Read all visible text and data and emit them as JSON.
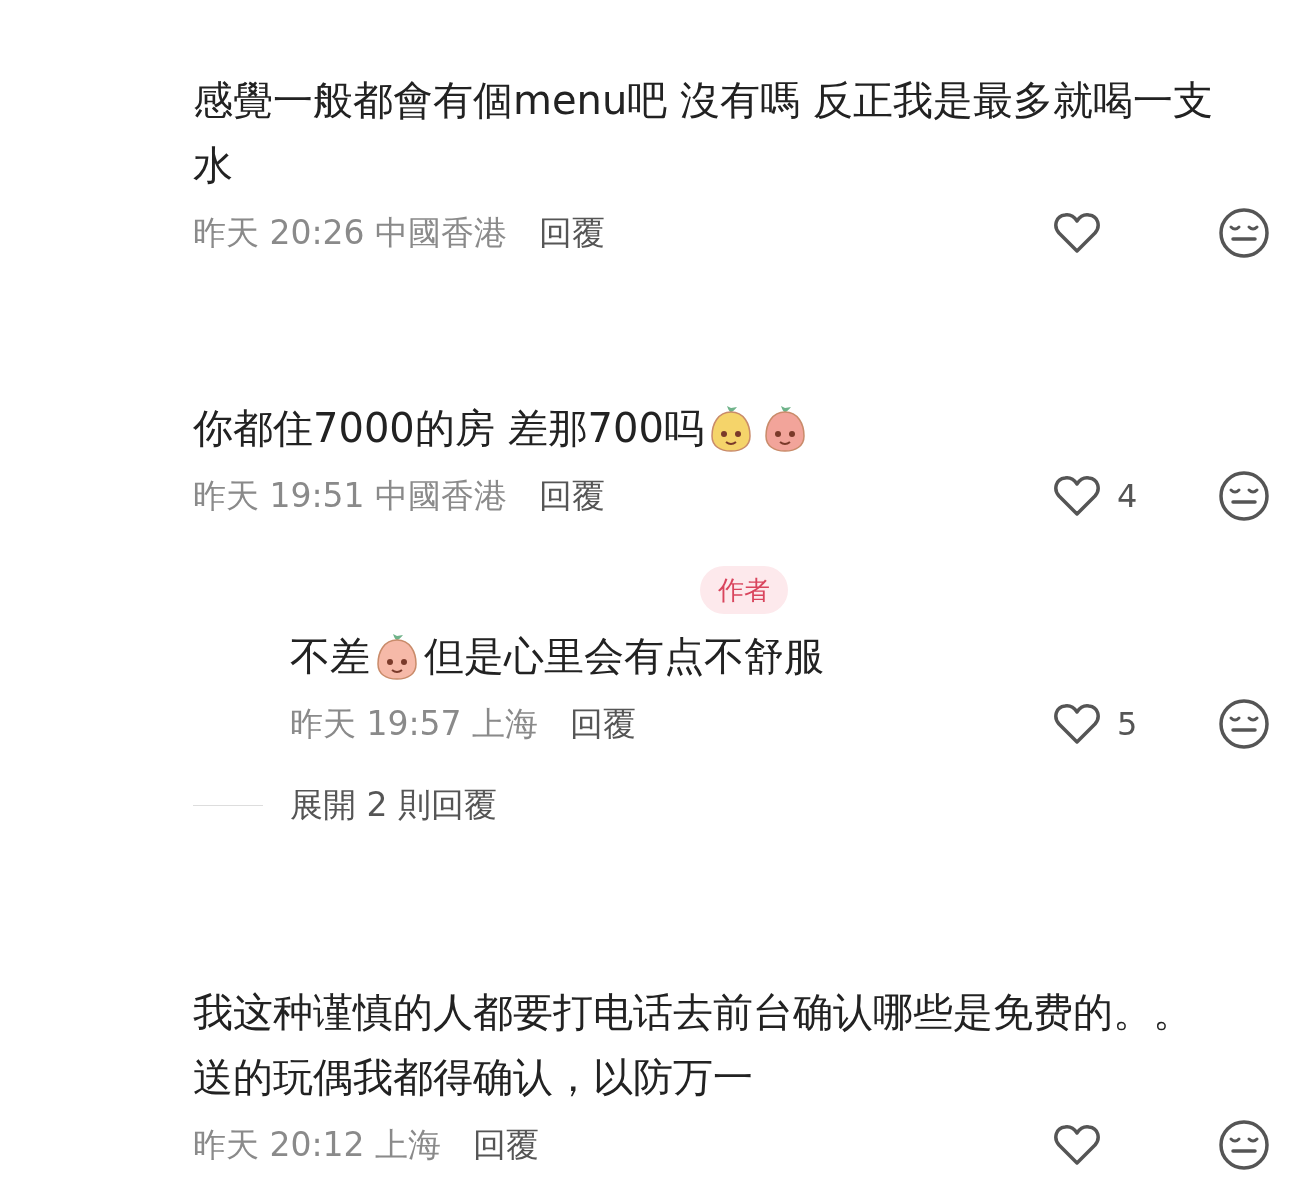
{
  "comments": [
    {
      "lines": [
        [
          {
            "kind": "text",
            "text": "感覺一般都會有個menu吧 沒有嗎 反正我是最多就喝一支"
          }
        ],
        [
          {
            "kind": "text",
            "text": "水"
          }
        ]
      ],
      "time": "昨天 20:26 中國香港",
      "reply_label": "回覆"
    },
    {
      "lines": [
        [
          {
            "kind": "text",
            "text": "你都住7000的房 差那700吗"
          },
          {
            "kind": "sticker",
            "color": "#f5d46a"
          },
          {
            "kind": "sticker",
            "color": "#f2a49a"
          }
        ]
      ],
      "time": "昨天 19:51 中國香港",
      "reply_label": "回覆",
      "likes": "4",
      "replies": [
        {
          "badge": "作者",
          "lines": [
            [
              {
                "kind": "text",
                "text": "不差"
              },
              {
                "kind": "sticker",
                "color": "#f6b9a8"
              },
              {
                "kind": "text",
                "text": "但是心里会有点不舒服"
              }
            ]
          ],
          "time": "昨天 19:57 上海",
          "reply_label": "回覆",
          "likes": "5"
        }
      ],
      "expand": "展開 2 則回覆"
    },
    {
      "lines": [
        [
          {
            "kind": "text",
            "text": "我这种谨慎的人都要打电话去前台确认哪些是免费的。。"
          }
        ],
        [
          {
            "kind": "text",
            "text": "送的玩偶我都得确认，以防万一"
          }
        ]
      ],
      "time": "昨天 20:12 上海",
      "reply_label": "回覆"
    }
  ]
}
